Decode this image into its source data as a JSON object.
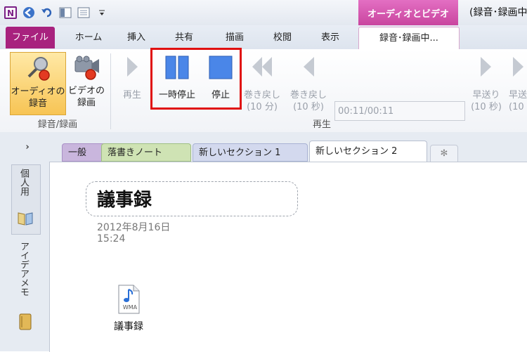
{
  "title_bar": {
    "context_group": "オーディオとビデオ",
    "window_title": "(録音･録画中"
  },
  "tabs": [
    {
      "label": "ファイル"
    },
    {
      "label": "ホーム"
    },
    {
      "label": "挿入"
    },
    {
      "label": "共有"
    },
    {
      "label": "描画"
    },
    {
      "label": "校閲"
    },
    {
      "label": "表示"
    },
    {
      "label": "録音･録画中..."
    }
  ],
  "ribbon": {
    "record_group": {
      "label": "録音/録画",
      "audio_line1": "オーディオの",
      "audio_line2": "録音",
      "video_line1": "ビデオの",
      "video_line2": "録画"
    },
    "playback_group": {
      "label": "再生",
      "play": "再生",
      "pause": "一時停止",
      "stop": "停止",
      "rewind10m_line1": "巻き戻し",
      "rewind10m_line2": "(10 分)",
      "rewind10s_line1": "巻き戻し",
      "rewind10s_line2": "(10 秒)",
      "time": "00:11/00:11",
      "ff10s_line1": "早送り",
      "ff10s_line2": "(10 秒)",
      "ff_partial_line1": "早送",
      "ff_partial_line2": "(10"
    }
  },
  "sections": [
    {
      "label": "一般"
    },
    {
      "label": "落書きノート"
    },
    {
      "label": "新しいセクション 1"
    },
    {
      "label": "新しいセクション 2"
    }
  ],
  "notebooks": [
    {
      "label": "個人用"
    },
    {
      "label": "アイデアメモ"
    }
  ],
  "page": {
    "title": "議事録",
    "date": "2012年8月16日",
    "time": "15:24",
    "attachment": {
      "type_badge": "WMA",
      "label": "議事録"
    }
  },
  "colors": {
    "accent": "#a8227e",
    "context": "#d455ae",
    "highlight": "#e01010",
    "button_blue": "#4a86e8"
  }
}
